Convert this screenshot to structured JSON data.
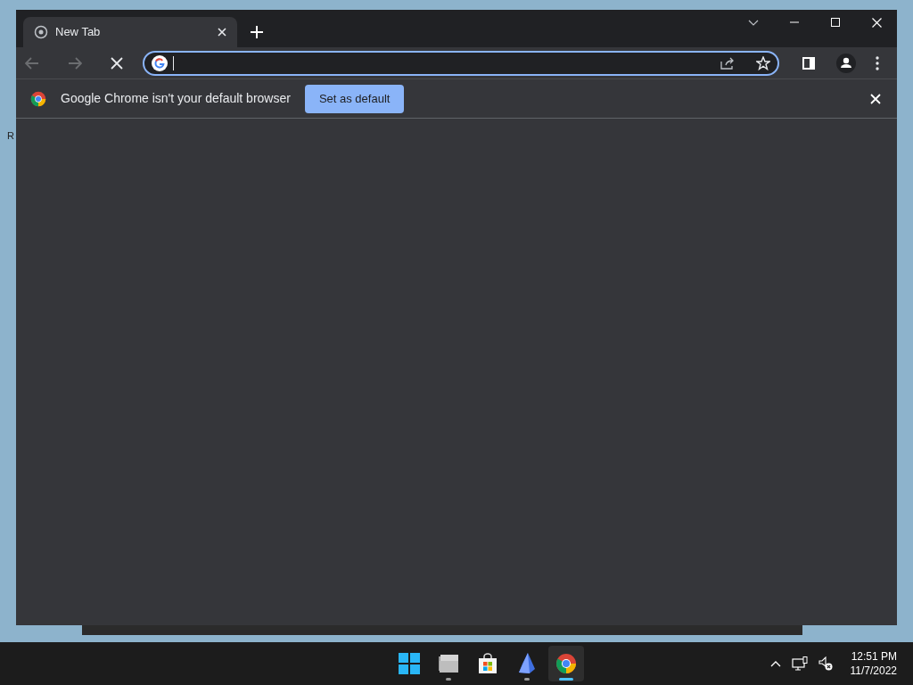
{
  "desktop": {
    "label": "R"
  },
  "tabs": [
    {
      "title": "New Tab",
      "selected": true
    }
  ],
  "toolbar": {
    "back_disabled": true,
    "forward_disabled": true,
    "loading": true
  },
  "omnibox": {
    "focused": true
  },
  "infobar": {
    "message": "Google Chrome isn't your default browser",
    "button": "Set as default"
  },
  "taskbar": {
    "apps": [
      {
        "kind": "start",
        "running": false,
        "active": false
      },
      {
        "kind": "files",
        "running": true,
        "active": false
      },
      {
        "kind": "store",
        "running": false,
        "active": false
      },
      {
        "kind": "app",
        "running": true,
        "active": false
      },
      {
        "kind": "chrome",
        "running": true,
        "active": true
      }
    ],
    "time": "12:51 PM",
    "date": "11/7/2022"
  }
}
